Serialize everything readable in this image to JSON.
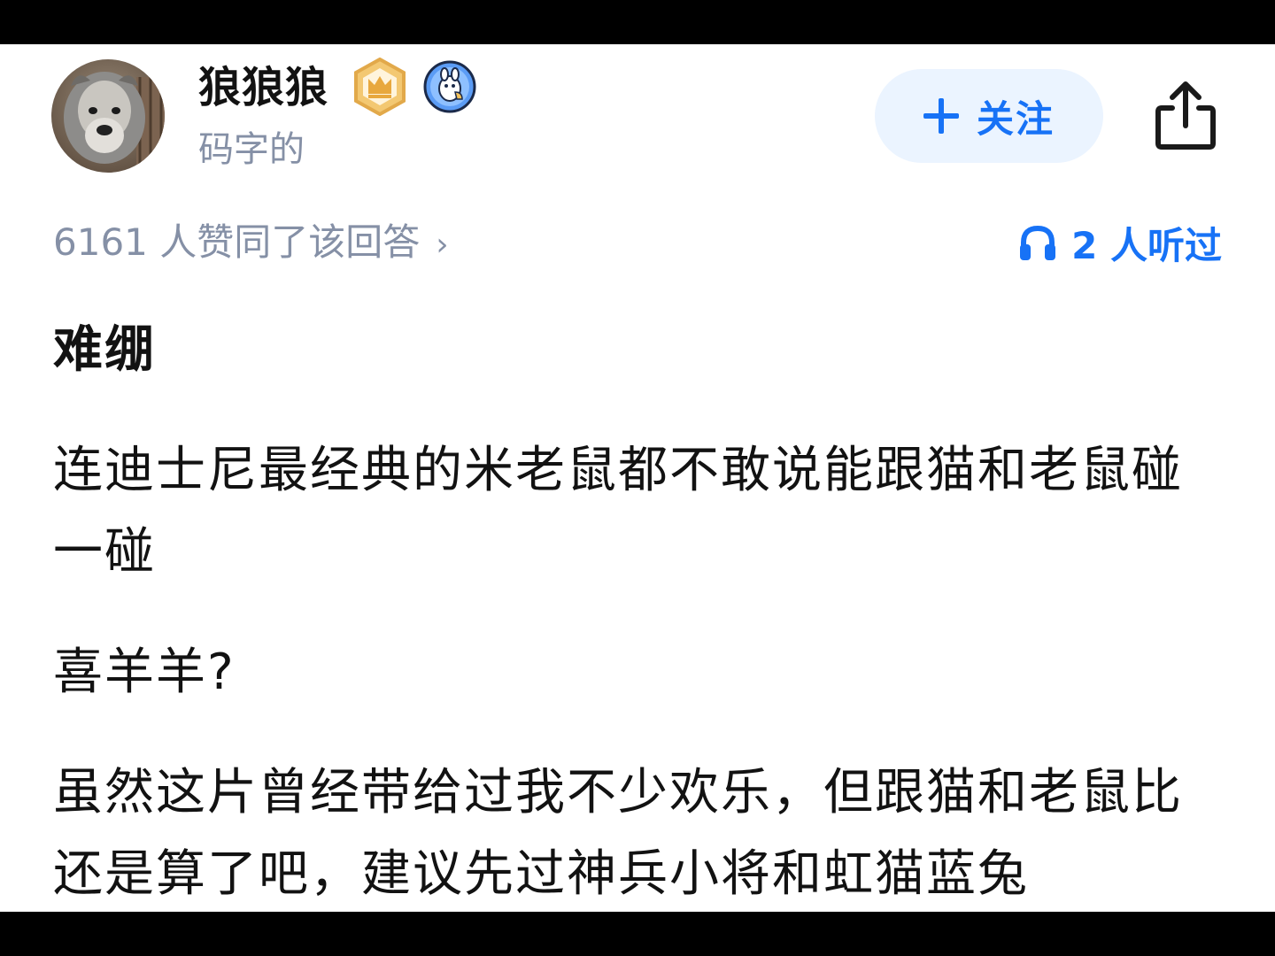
{
  "author": {
    "name": "狼狼狼",
    "bio": "码字的",
    "avatar": "dog-avatar",
    "badges": [
      "crown-badge-icon",
      "mascot-badge-icon"
    ]
  },
  "actions": {
    "follow_label": "关注",
    "follow_icon": "plus-icon",
    "share_icon": "share-icon"
  },
  "stats": {
    "likes_text": "6161 人赞同了该回答",
    "likes_chevron": "›",
    "listen_text": "2 人听过",
    "listen_icon": "headphone-icon"
  },
  "answer": {
    "paragraphs": [
      "难绷",
      "连迪士尼最经典的米老鼠都不敢说能跟猫和老鼠碰一碰",
      "喜羊羊?",
      "虽然这片曾经带给过我不少欢乐，但跟猫和老鼠比还是算了吧，建议先过神兵小将和虹猫蓝兔"
    ]
  },
  "colors": {
    "accent": "#1772f6",
    "follow_bg": "#ebf4ff",
    "muted": "#8590a6",
    "text": "#121212",
    "badge_gold": "#e8b04b"
  }
}
